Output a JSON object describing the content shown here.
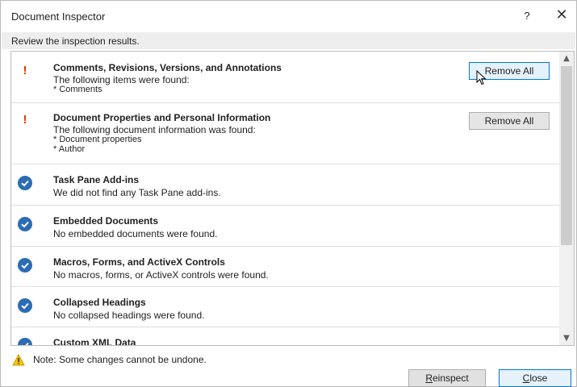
{
  "window": {
    "title": "Document Inspector",
    "help_label": "?",
    "close_label": "✕"
  },
  "subtitle": "Review the inspection results.",
  "results": [
    {
      "status": "warning",
      "status_icon": "exclamation-icon",
      "title": "Comments, Revisions, Versions, and Annotations",
      "lines": [
        "The following items were found:",
        "* Comments"
      ],
      "action_label": "Remove All"
    },
    {
      "status": "warning",
      "status_icon": "exclamation-icon",
      "title": "Document Properties and Personal Information",
      "lines": [
        "The following document information was found:",
        "* Document properties",
        "* Author"
      ],
      "action_label": "Remove All"
    },
    {
      "status": "ok",
      "status_icon": "checkmark-icon",
      "title": "Task Pane Add-ins",
      "lines": [
        "We did not find any Task Pane add-ins."
      ]
    },
    {
      "status": "ok",
      "status_icon": "checkmark-icon",
      "title": "Embedded Documents",
      "lines": [
        "No embedded documents were found."
      ]
    },
    {
      "status": "ok",
      "status_icon": "checkmark-icon",
      "title": "Macros, Forms, and ActiveX Controls",
      "lines": [
        "No macros, forms, or ActiveX controls were found."
      ]
    },
    {
      "status": "ok",
      "status_icon": "checkmark-icon",
      "title": "Collapsed Headings",
      "lines": [
        "No collapsed headings were found."
      ]
    },
    {
      "status": "ok",
      "status_icon": "checkmark-icon",
      "title": "Custom XML Data",
      "lines": []
    }
  ],
  "scrollbar": {
    "up_icon": "chevron-up-icon",
    "down_icon": "chevron-down-icon"
  },
  "footer": {
    "note_icon": "warning-triangle-icon",
    "note": "Note: Some changes cannot be undone.",
    "reinspect_label": "Reinspect",
    "reinspect_access_key": "R",
    "close_label": "Close",
    "close_access_key": "C"
  },
  "colors": {
    "warning_mark": "#d83b01",
    "check_circle": "#2b6cb5",
    "focus_border": "#0078d7",
    "subtitle_bar": "#eeeeee"
  }
}
